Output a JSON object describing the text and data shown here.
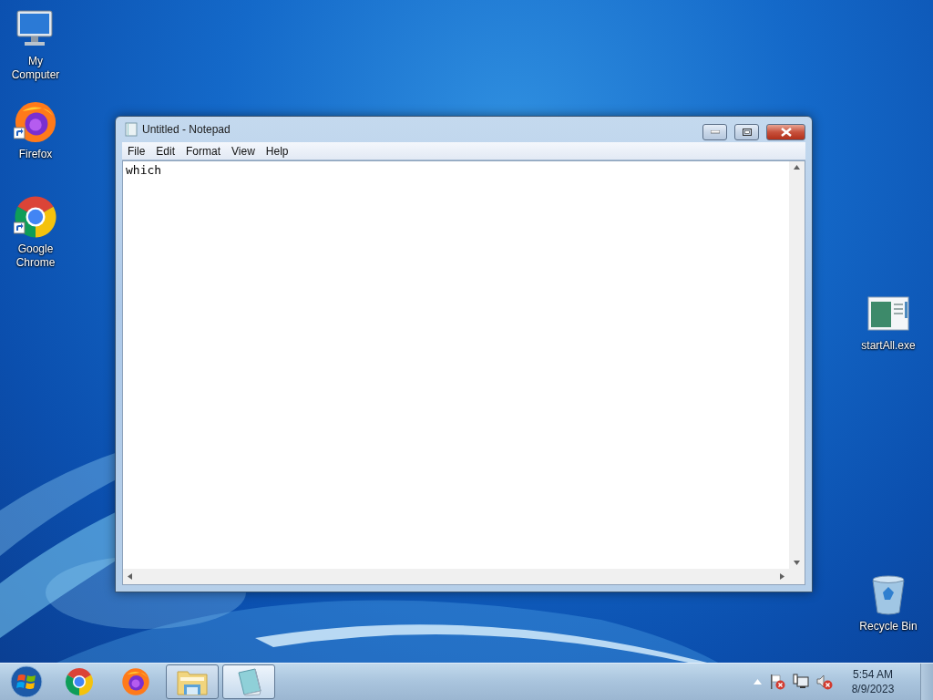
{
  "desktop_icons": [
    {
      "kind": "computer",
      "label": "My Computer",
      "shortcut": false
    },
    {
      "kind": "firefox",
      "label": "Firefox",
      "shortcut": true
    },
    {
      "kind": "chrome",
      "label": "Google Chrome",
      "shortcut": true
    },
    {
      "kind": "program",
      "label": "startAll.exe",
      "shortcut": false
    },
    {
      "kind": "recycle",
      "label": "Recycle Bin",
      "shortcut": false
    }
  ],
  "window": {
    "title": "Untitled - Notepad",
    "menu": [
      "File",
      "Edit",
      "Format",
      "View",
      "Help"
    ],
    "text": "which"
  },
  "taskbar": {
    "items": [
      {
        "kind": "chrome",
        "running": false,
        "selected": false
      },
      {
        "kind": "firefox",
        "running": false,
        "selected": false
      },
      {
        "kind": "explorer",
        "running": true,
        "selected": false
      },
      {
        "kind": "notepad",
        "running": true,
        "selected": true
      }
    ],
    "clock": {
      "time": "5:54 AM",
      "date": "8/9/2023"
    }
  }
}
